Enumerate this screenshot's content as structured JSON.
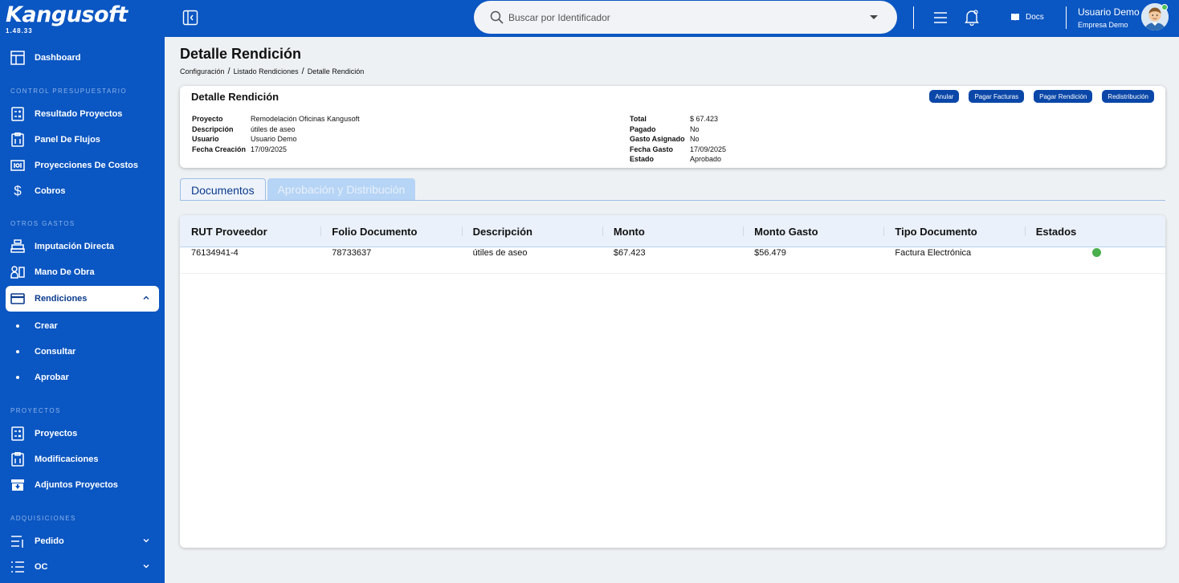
{
  "app": {
    "logo": "Kangusoft",
    "version": "1.48.33"
  },
  "sidebar": {
    "dashboard": "Dashboard",
    "sections": {
      "control": "CONTROL PRESUPUESTARIO",
      "otros": "OTROS GASTOS",
      "proyectos": "PROYECTOS",
      "adquisiciones": "ADQUISICIONES"
    },
    "control_items": [
      "Resultado Proyectos",
      "Panel De Flujos",
      "Proyecciones De Costos",
      "Cobros"
    ],
    "otros_items": [
      "Imputación Directa",
      "Mano De Obra",
      "Rendiciones"
    ],
    "rendiciones_sub": [
      "Crear",
      "Consultar",
      "Aprobar"
    ],
    "proyectos_items": [
      "Proyectos",
      "Modificaciones",
      "Adjuntos Proyectos"
    ],
    "adquisiciones_items": [
      "Pedido",
      "OC"
    ]
  },
  "topbar": {
    "search_placeholder": "Buscar por Identificador",
    "docs": "Docs",
    "user_name": "Usuario Demo",
    "user_company": "Empresa Demo"
  },
  "page": {
    "title": "Detalle Rendición",
    "breadcrumb": [
      "Configuración",
      "Listado Rendiciones",
      "Detalle Rendición"
    ]
  },
  "detail": {
    "title": "Detalle Rendición",
    "actions": [
      "Anular",
      "Pagar Facturas",
      "Pagar Rendición",
      "Redistribución"
    ],
    "left": [
      {
        "k": "Proyecto",
        "v": "Remodelación Oficinas Kangusoft"
      },
      {
        "k": "Descripción",
        "v": "útiles de aseo"
      },
      {
        "k": "Usuario",
        "v": "Usuario Demo"
      },
      {
        "k": "Fecha Creación",
        "v": "17/09/2025"
      }
    ],
    "right": [
      {
        "k": "Total",
        "v": "$ 67.423"
      },
      {
        "k": "Pagado",
        "v": "No"
      },
      {
        "k": "Gasto Asignado",
        "v": "No"
      },
      {
        "k": "Fecha Gasto",
        "v": "17/09/2025"
      },
      {
        "k": "Estado",
        "v": "Aprobado"
      }
    ]
  },
  "tabs": [
    "Documentos",
    "Aprobación y Distribución"
  ],
  "table": {
    "headers": [
      "RUT Proveedor",
      "Folio Documento",
      "Descripción",
      "Monto",
      "Monto Gasto",
      "Tipo Documento",
      "Estados"
    ],
    "rows": [
      [
        "76134941-4",
        "78733637",
        "útiles de aseo",
        "$67.423",
        "$56.479",
        "Factura Electrónica"
      ]
    ],
    "status_color": "#4aaf4e"
  },
  "colors": {
    "primary": "#0a56c2",
    "button": "#0a47a8",
    "status_ok": "#4aaf4e"
  }
}
